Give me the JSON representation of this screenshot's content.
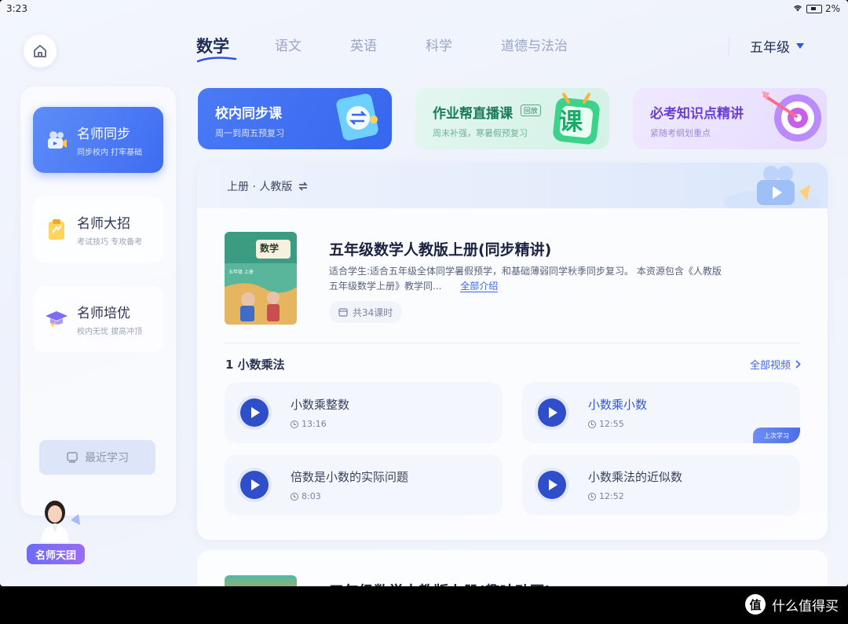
{
  "status": {
    "time": "3:23",
    "battery": "2%"
  },
  "subjects": {
    "tabs": [
      {
        "label": "数学"
      },
      {
        "label": "语文"
      },
      {
        "label": "英语"
      },
      {
        "label": "科学"
      },
      {
        "label": "道德与法治"
      }
    ],
    "active": "数学"
  },
  "grade": {
    "label": "五年级"
  },
  "sidebar": {
    "items": [
      {
        "title": "名师同步",
        "subtitle": "同步校内 打牢基础"
      },
      {
        "title": "名师大招",
        "subtitle": "考试技巧 专攻备考"
      },
      {
        "title": "名师培优",
        "subtitle": "校内无忧 拔高冲顶"
      }
    ],
    "recent": "最近学习"
  },
  "team_badge": "名师天团",
  "top_cards": {
    "sync": {
      "title": "校内同步课",
      "subtitle": "周一到周五预复习"
    },
    "live": {
      "title": "作业帮直播课",
      "tag": "回放",
      "subtitle": "周末补强，寒暑假预复习",
      "icon_char": "课"
    },
    "key": {
      "title": "必考知识点精讲",
      "subtitle": "紧随考纲划重点"
    }
  },
  "panel": {
    "edition": "上册 · 人教版",
    "book": {
      "cover_label": "数学",
      "cover_sub": "五年级 上册",
      "title": "五年级数学人教版上册(同步精讲)",
      "desc": "适合学生:适合五年级全体同学暑假预学，和基础薄弱同学秋季同步复习。 本资源包含《人教版五年级数学上册》教学同...",
      "more": "全部介绍",
      "lessons_count": "共34课时"
    },
    "chapter": {
      "title": "1 小数乘法",
      "all": "全部视频"
    },
    "lessons": [
      {
        "name": "小数乘整数",
        "duration": "13:16"
      },
      {
        "name": "小数乘小数",
        "duration": "12:55",
        "tag": "上次学习"
      },
      {
        "name": "倍数是小数的实际问题",
        "duration": "8:03"
      },
      {
        "name": "小数乘法的近似数",
        "duration": "12:52"
      }
    ]
  },
  "panel2": {
    "title": "五年级数学人教版上册(趣味动画)"
  },
  "watermark": {
    "logo": "值",
    "text": "什么值得买"
  },
  "colors": {
    "accent": "#3a66ee",
    "play": "#2f4ec9",
    "sync_card": "#4a7af5",
    "live_card": "#d3f1e6",
    "key_card": "#e6dcff"
  }
}
